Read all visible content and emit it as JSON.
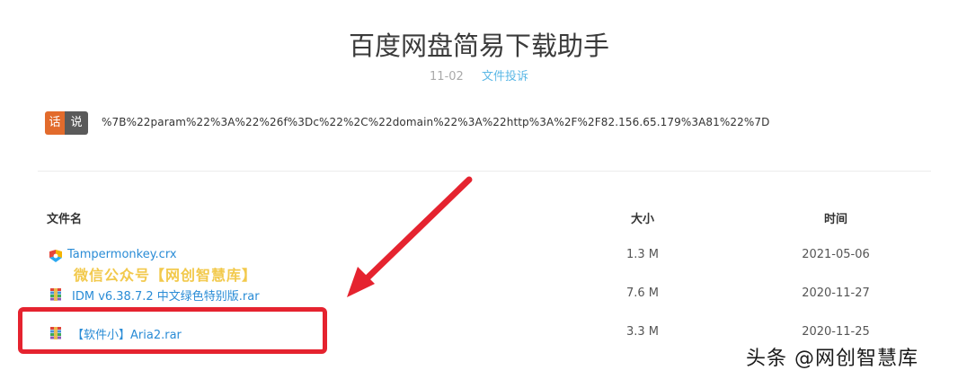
{
  "page": {
    "title": "百度网盘简易下载助手",
    "date": "11-02",
    "report_link": "文件投诉"
  },
  "say": {
    "badge_left": "话",
    "badge_right": "说",
    "text": "%7B%22param%22%3A%22%26f%3Dc%22%2C%22domain%22%3A%22http%3A%2F%2F82.156.65.179%3A81%22%7D"
  },
  "table": {
    "headers": {
      "name": "文件名",
      "size": "大小",
      "time": "时间"
    },
    "rows": [
      {
        "name": "Tampermonkey.crx",
        "size": "1.3 M",
        "time": "2021-05-06",
        "icon": "crx-file-icon"
      },
      {
        "name": "IDM v6.38.7.2 中文绿色特别版.rar",
        "size": "7.6 M",
        "time": "2020-11-27",
        "icon": "rar-file-icon"
      },
      {
        "name": "【软件小】Aria2.rar",
        "size": "3.3 M",
        "time": "2020-11-25",
        "icon": "rar-file-icon"
      }
    ]
  },
  "overlay": {
    "wechat_watermark": "微信公众号【网创智慧库】",
    "corner_watermark": "头条 @网创智慧库",
    "highlight_color": "#e5232f"
  }
}
